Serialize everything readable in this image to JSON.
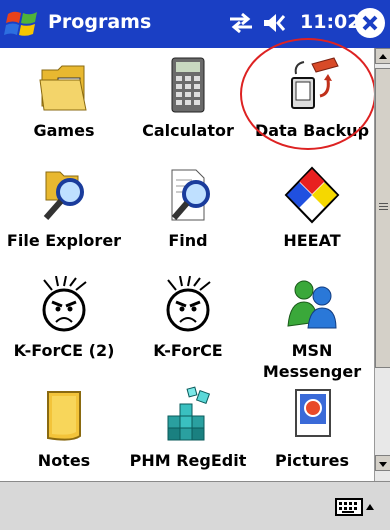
{
  "titlebar": {
    "title": "Programs",
    "time": "11:02"
  },
  "programs": [
    {
      "label": "Games",
      "icon": "games-folder-icon"
    },
    {
      "label": "Calculator",
      "icon": "calculator-icon"
    },
    {
      "label": "Data Backup",
      "icon": "data-backup-icon"
    },
    {
      "label": "File Explorer",
      "icon": "file-explorer-icon"
    },
    {
      "label": "Find",
      "icon": "find-icon"
    },
    {
      "label": "HEEAT",
      "icon": "hazard-diamond-icon"
    },
    {
      "label": "K-ForCE (2)",
      "icon": "kforce-face-icon"
    },
    {
      "label": "K-ForCE",
      "icon": "kforce-face-icon"
    },
    {
      "label": "MSN\nMessenger",
      "icon": "msn-messenger-icon"
    },
    {
      "label": "Notes",
      "icon": "notes-icon"
    },
    {
      "label": "PHM RegEdit",
      "icon": "regedit-cubes-icon"
    },
    {
      "label": "Pictures",
      "icon": "pictures-icon"
    }
  ],
  "colors": {
    "titlebar": "#1a3fc4",
    "highlight_circle": "#dd2222"
  }
}
